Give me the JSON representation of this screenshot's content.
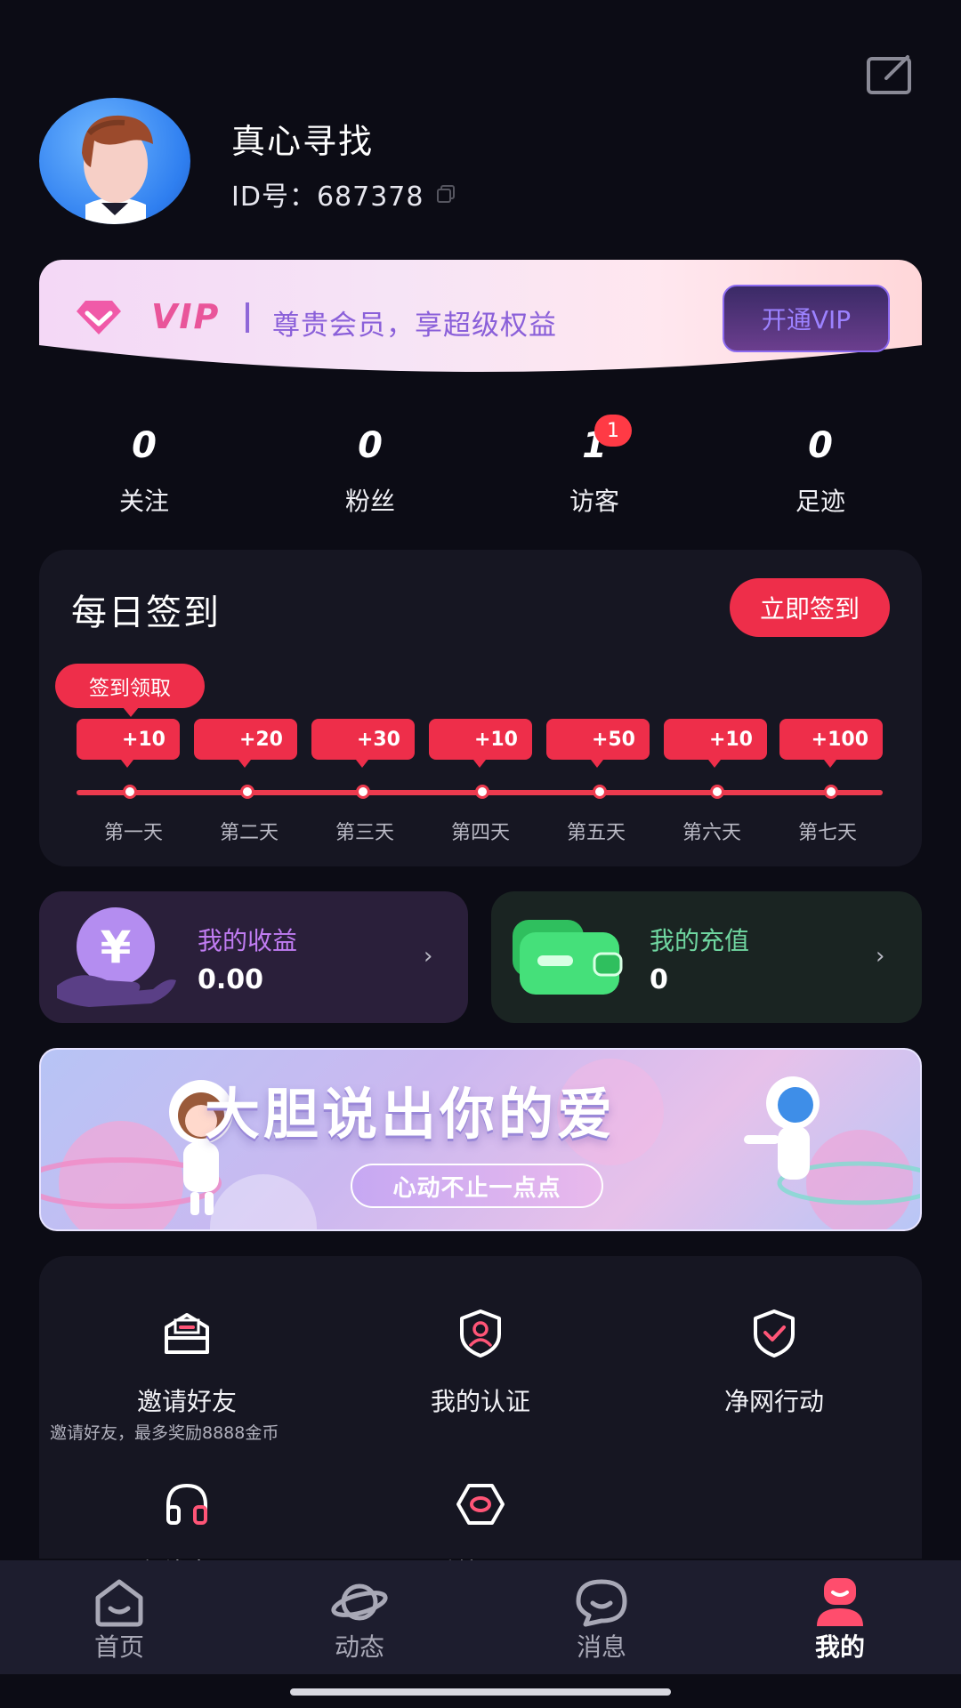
{
  "header": {
    "username": "真心寻找",
    "id_text": "ID号：687378"
  },
  "vip": {
    "badge": "VIP",
    "slogan": "尊贵会员，享超级权益",
    "button": "开通VIP"
  },
  "stats": [
    {
      "value": "0",
      "label": "关注"
    },
    {
      "value": "0",
      "label": "粉丝"
    },
    {
      "value": "1",
      "label": "访客",
      "badge": "1"
    },
    {
      "value": "0",
      "label": "足迹"
    }
  ],
  "checkin": {
    "title": "每日签到",
    "button": "立即签到",
    "tip": "签到领取",
    "rewards": [
      "+10",
      "+20",
      "+30",
      "+10",
      "+50",
      "+10",
      "+100"
    ],
    "days": [
      "第一天",
      "第二天",
      "第三天",
      "第四天",
      "第五天",
      "第六天",
      "第七天"
    ]
  },
  "wallet": {
    "income": {
      "title": "我的收益",
      "value": "0.00",
      "title_color": "#c07cf2"
    },
    "recharge": {
      "title": "我的充值",
      "value": "0",
      "title_color": "#6fd6a0"
    }
  },
  "promo": {
    "title": "大胆说出你的爱",
    "subtitle": "心动不止一点点"
  },
  "menu": {
    "items": [
      {
        "label": "邀请好友",
        "icon": "envelope-icon",
        "sub": "邀请好友，最多奖励8888金币"
      },
      {
        "label": "我的认证",
        "icon": "verified-user-shield-icon"
      },
      {
        "label": "净网行动",
        "icon": "shield-check-icon"
      },
      {
        "label": "在线客服",
        "icon": "headset-icon"
      },
      {
        "label": "系统设置",
        "icon": "settings-hexagon-icon"
      }
    ]
  },
  "nav": {
    "items": [
      {
        "label": "首页",
        "icon": "home-icon"
      },
      {
        "label": "动态",
        "icon": "planet-icon"
      },
      {
        "label": "消息",
        "icon": "chat-bubble-icon"
      },
      {
        "label": "我的",
        "icon": "profile-icon",
        "active": true
      }
    ],
    "active_color": "#ff4d6d"
  },
  "colors": {
    "background": "#0c0c15",
    "accent_red": "#ee2e4a",
    "vip_purple": "#8a5fd9"
  }
}
